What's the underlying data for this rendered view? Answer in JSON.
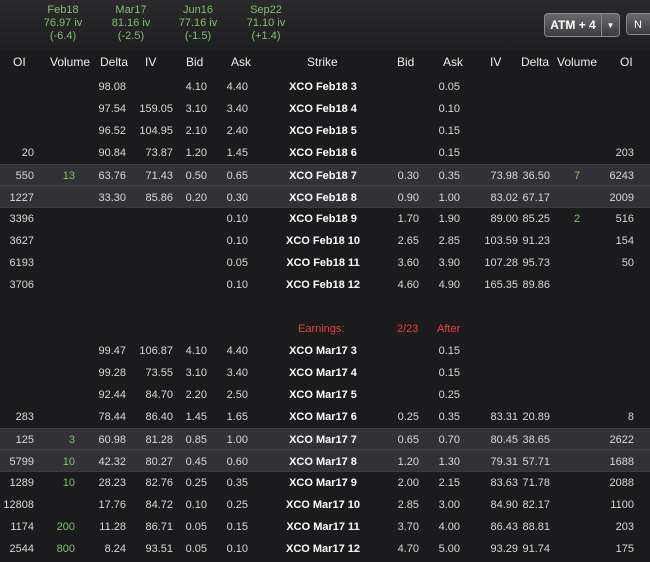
{
  "expirations": [
    {
      "month": "Feb18",
      "iv": "76.97 iv",
      "chg": "(-6.4)"
    },
    {
      "month": "Mar17",
      "iv": "81.16 iv",
      "chg": "(-2.5)"
    },
    {
      "month": "Jun16",
      "iv": "77.16 iv",
      "chg": "(-1.5)"
    },
    {
      "month": "Sep22",
      "iv": "71.10 iv",
      "chg": "(+1.4)"
    }
  ],
  "controls": {
    "atm_label": "ATM + 4",
    "next_label": "N"
  },
  "columns": {
    "calls_oi": "OI",
    "calls_volume": "Volume",
    "calls_delta": "Delta",
    "calls_iv": "IV",
    "calls_bid": "Bid",
    "calls_ask": "Ask",
    "strike": "Strike",
    "puts_bid": "Bid",
    "puts_ask": "Ask",
    "puts_iv": "IV",
    "puts_delta": "Delta",
    "puts_volume": "Volume",
    "puts_oi": "OI"
  },
  "feb18": [
    {
      "coi": "",
      "cvol": "",
      "cdelta": "98.08",
      "civ": "",
      "cbid": "4.10",
      "cask": "4.40",
      "strike": "XCO Feb18 3",
      "pbid": "",
      "pask": "0.05",
      "piv": "",
      "pdelta": "",
      "pvol": "",
      "poi": ""
    },
    {
      "coi": "",
      "cvol": "",
      "cdelta": "97.54",
      "civ": "159.05",
      "cbid": "3.10",
      "cask": "3.40",
      "strike": "XCO Feb18 4",
      "pbid": "",
      "pask": "0.10",
      "piv": "",
      "pdelta": "",
      "pvol": "",
      "poi": ""
    },
    {
      "coi": "",
      "cvol": "",
      "cdelta": "96.52",
      "civ": "104.95",
      "cbid": "2.10",
      "cask": "2.40",
      "strike": "XCO Feb18 5",
      "pbid": "",
      "pask": "0.15",
      "piv": "",
      "pdelta": "",
      "pvol": "",
      "poi": ""
    },
    {
      "coi": "20",
      "cvol": "",
      "cdelta": "90.84",
      "civ": "73.87",
      "cbid": "1.20",
      "cask": "1.45",
      "strike": "XCO Feb18 6",
      "pbid": "",
      "pask": "0.15",
      "piv": "",
      "pdelta": "",
      "pvol": "",
      "poi": "203"
    },
    {
      "coi": "550",
      "cvol": "13",
      "cdelta": "63.76",
      "civ": "71.43",
      "cbid": "0.50",
      "cask": "0.65",
      "strike": "XCO Feb18 7",
      "pbid": "0.30",
      "pask": "0.35",
      "piv": "73.98",
      "pdelta": "36.50",
      "pvol": "7",
      "poi": "6243"
    },
    {
      "coi": "1227",
      "cvol": "",
      "cdelta": "33.30",
      "civ": "85.86",
      "cbid": "0.20",
      "cask": "0.30",
      "strike": "XCO Feb18 8",
      "pbid": "0.90",
      "pask": "1.00",
      "piv": "83.02",
      "pdelta": "67.17",
      "pvol": "",
      "poi": "2009"
    },
    {
      "coi": "3396",
      "cvol": "",
      "cdelta": "",
      "civ": "",
      "cbid": "",
      "cask": "0.10",
      "strike": "XCO Feb18 9",
      "pbid": "1.70",
      "pask": "1.90",
      "piv": "89.00",
      "pdelta": "85.25",
      "pvol": "2",
      "poi": "516"
    },
    {
      "coi": "3627",
      "cvol": "",
      "cdelta": "",
      "civ": "",
      "cbid": "",
      "cask": "0.10",
      "strike": "XCO Feb18 10",
      "pbid": "2.65",
      "pask": "2.85",
      "piv": "103.59",
      "pdelta": "91.23",
      "pvol": "",
      "poi": "154"
    },
    {
      "coi": "6193",
      "cvol": "",
      "cdelta": "",
      "civ": "",
      "cbid": "",
      "cask": "0.05",
      "strike": "XCO Feb18 11",
      "pbid": "3.60",
      "pask": "3.90",
      "piv": "107.28",
      "pdelta": "95.73",
      "pvol": "",
      "poi": "50"
    },
    {
      "coi": "3706",
      "cvol": "",
      "cdelta": "",
      "civ": "",
      "cbid": "",
      "cask": "0.10",
      "strike": "XCO Feb18 12",
      "pbid": "4.60",
      "pask": "4.90",
      "piv": "165.35",
      "pdelta": "89.86",
      "pvol": "",
      "poi": ""
    }
  ],
  "earnings": {
    "label": "Earnings:",
    "date": "2/23",
    "timing": "After"
  },
  "mar17": [
    {
      "coi": "",
      "cvol": "",
      "cdelta": "99.47",
      "civ": "106.87",
      "cbid": "4.10",
      "cask": "4.40",
      "strike": "XCO Mar17 3",
      "pbid": "",
      "pask": "0.15",
      "piv": "",
      "pdelta": "",
      "pvol": "",
      "poi": ""
    },
    {
      "coi": "",
      "cvol": "",
      "cdelta": "99.28",
      "civ": "73.55",
      "cbid": "3.10",
      "cask": "3.40",
      "strike": "XCO Mar17 4",
      "pbid": "",
      "pask": "0.15",
      "piv": "",
      "pdelta": "",
      "pvol": "",
      "poi": ""
    },
    {
      "coi": "",
      "cvol": "",
      "cdelta": "92.44",
      "civ": "84.70",
      "cbid": "2.20",
      "cask": "2.50",
      "strike": "XCO Mar17 5",
      "pbid": "",
      "pask": "0.25",
      "piv": "",
      "pdelta": "",
      "pvol": "",
      "poi": ""
    },
    {
      "coi": "283",
      "cvol": "",
      "cdelta": "78.44",
      "civ": "86.40",
      "cbid": "1.45",
      "cask": "1.65",
      "strike": "XCO Mar17 6",
      "pbid": "0.25",
      "pask": "0.35",
      "piv": "83.31",
      "pdelta": "20.89",
      "pvol": "",
      "poi": "8"
    },
    {
      "coi": "125",
      "cvol": "3",
      "cdelta": "60.98",
      "civ": "81.28",
      "cbid": "0.85",
      "cask": "1.00",
      "strike": "XCO Mar17 7",
      "pbid": "0.65",
      "pask": "0.70",
      "piv": "80.45",
      "pdelta": "38.65",
      "pvol": "",
      "poi": "2622"
    },
    {
      "coi": "5799",
      "cvol": "10",
      "cdelta": "42.32",
      "civ": "80.27",
      "cbid": "0.45",
      "cask": "0.60",
      "strike": "XCO Mar17 8",
      "pbid": "1.20",
      "pask": "1.30",
      "piv": "79.31",
      "pdelta": "57.71",
      "pvol": "",
      "poi": "1688"
    },
    {
      "coi": "1289",
      "cvol": "10",
      "cdelta": "28.23",
      "civ": "82.76",
      "cbid": "0.25",
      "cask": "0.35",
      "strike": "XCO Mar17 9",
      "pbid": "2.00",
      "pask": "2.15",
      "piv": "83.63",
      "pdelta": "71.78",
      "pvol": "",
      "poi": "2088"
    },
    {
      "coi": "12808",
      "cvol": "",
      "cdelta": "17.76",
      "civ": "84.72",
      "cbid": "0.10",
      "cask": "0.25",
      "strike": "XCO Mar17 10",
      "pbid": "2.85",
      "pask": "3.00",
      "piv": "84.90",
      "pdelta": "82.17",
      "pvol": "",
      "poi": "1100"
    },
    {
      "coi": "1174",
      "cvol": "200",
      "cdelta": "11.28",
      "civ": "86.71",
      "cbid": "0.05",
      "cask": "0.15",
      "strike": "XCO Mar17 11",
      "pbid": "3.70",
      "pask": "4.00",
      "piv": "86.43",
      "pdelta": "88.81",
      "pvol": "",
      "poi": "203"
    },
    {
      "coi": "2544",
      "cvol": "800",
      "cdelta": "8.24",
      "civ": "93.51",
      "cbid": "0.05",
      "cask": "0.10",
      "strike": "XCO Mar17 12",
      "pbid": "4.70",
      "pask": "5.00",
      "piv": "93.29",
      "pdelta": "91.74",
      "pvol": "",
      "poi": "175"
    }
  ],
  "colors": {
    "background": "#1b1b1d",
    "highlight_row": "#323236",
    "volume_green": "#7fc26a",
    "earnings_red": "#e5433a",
    "strike_white": "#ffffff"
  }
}
